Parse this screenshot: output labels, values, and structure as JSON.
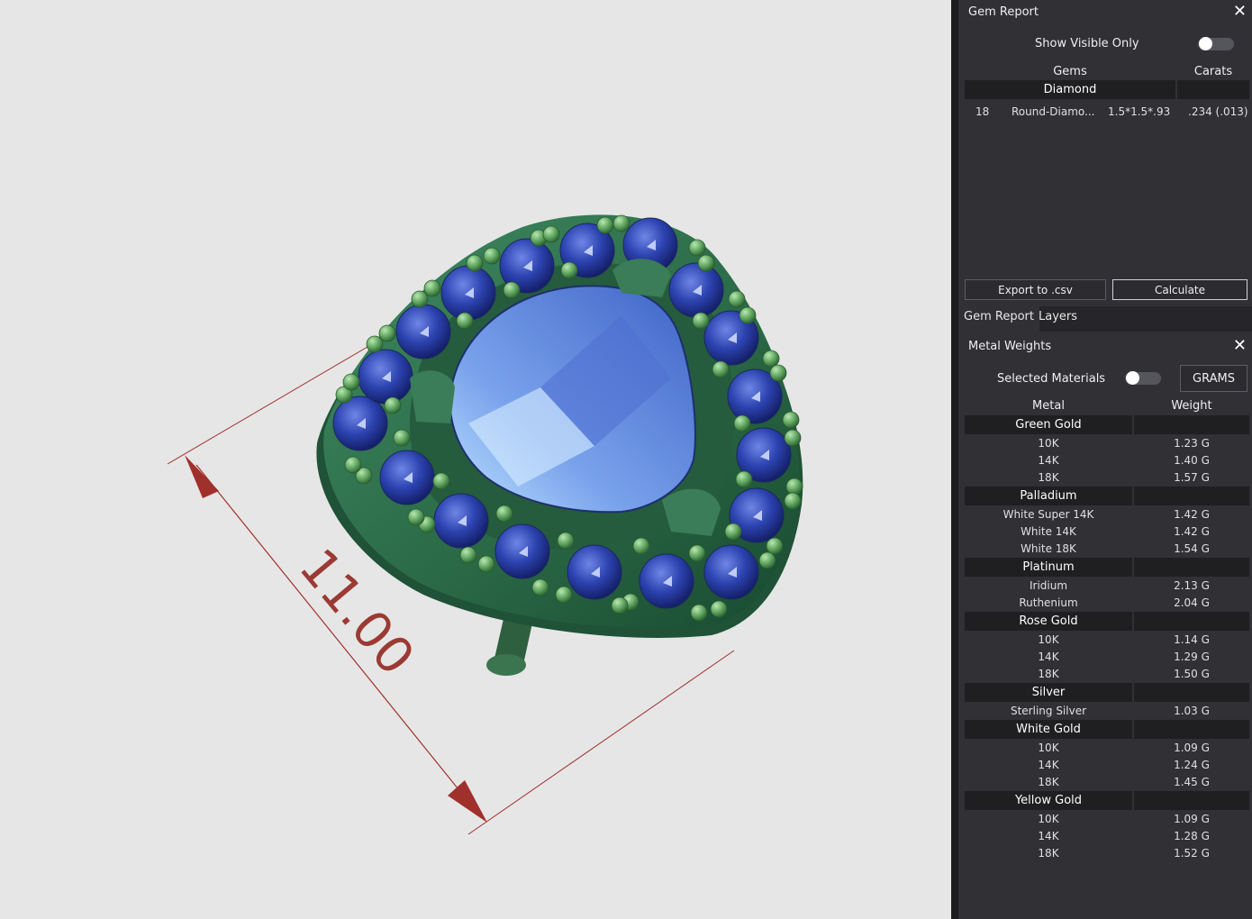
{
  "viewport": {
    "dimension_label": "11.00"
  },
  "gem_report": {
    "title": "Gem Report",
    "show_visible_only_label": "Show Visible Only",
    "show_visible_only_on": false,
    "col_gems": "Gems",
    "col_carats": "Carats",
    "group": "Diamond",
    "row": {
      "count": "18",
      "name": "Round-Diamo...",
      "size": "1.5*1.5*.93",
      "carats": ".234 (.013)"
    },
    "export_label": "Export to .csv",
    "calculate_label": "Calculate"
  },
  "tabs": [
    "Gem Report",
    "Layers"
  ],
  "metal_weights": {
    "title": "Metal Weights",
    "selected_materials_label": "Selected Materials",
    "selected_materials_on": false,
    "unit_button": "GRAMS",
    "col_metal": "Metal",
    "col_weight": "Weight",
    "groups": [
      {
        "name": "Green Gold",
        "rows": [
          {
            "metal": "10K",
            "weight": "1.23 G"
          },
          {
            "metal": "14K",
            "weight": "1.40 G"
          },
          {
            "metal": "18K",
            "weight": "1.57 G"
          }
        ]
      },
      {
        "name": "Palladium",
        "rows": [
          {
            "metal": "White Super 14K",
            "weight": "1.42 G"
          },
          {
            "metal": "White 14K",
            "weight": "1.42 G"
          },
          {
            "metal": "White 18K",
            "weight": "1.54 G"
          }
        ]
      },
      {
        "name": "Platinum",
        "rows": [
          {
            "metal": "Iridium",
            "weight": "2.13 G"
          },
          {
            "metal": "Ruthenium",
            "weight": "2.04 G"
          }
        ]
      },
      {
        "name": "Rose Gold",
        "rows": [
          {
            "metal": "10K",
            "weight": "1.14 G"
          },
          {
            "metal": "14K",
            "weight": "1.29 G"
          },
          {
            "metal": "18K",
            "weight": "1.50 G"
          }
        ]
      },
      {
        "name": "Silver",
        "rows": [
          {
            "metal": "Sterling Silver",
            "weight": "1.03 G"
          }
        ]
      },
      {
        "name": "White Gold",
        "rows": [
          {
            "metal": "10K",
            "weight": "1.09 G"
          },
          {
            "metal": "14K",
            "weight": "1.24 G"
          },
          {
            "metal": "18K",
            "weight": "1.45 G"
          }
        ]
      },
      {
        "name": "Yellow Gold",
        "rows": [
          {
            "metal": "10K",
            "weight": "1.09 G"
          },
          {
            "metal": "14K",
            "weight": "1.28 G"
          },
          {
            "metal": "18K",
            "weight": "1.52 G"
          }
        ]
      }
    ]
  },
  "colors": {
    "metal": "#2e6b48",
    "gem": "#2a3f9e",
    "center_gem": "#5b86d8",
    "bead": "#6fb36f",
    "dimension": "#a0302b",
    "panel_bg": "#303035"
  }
}
